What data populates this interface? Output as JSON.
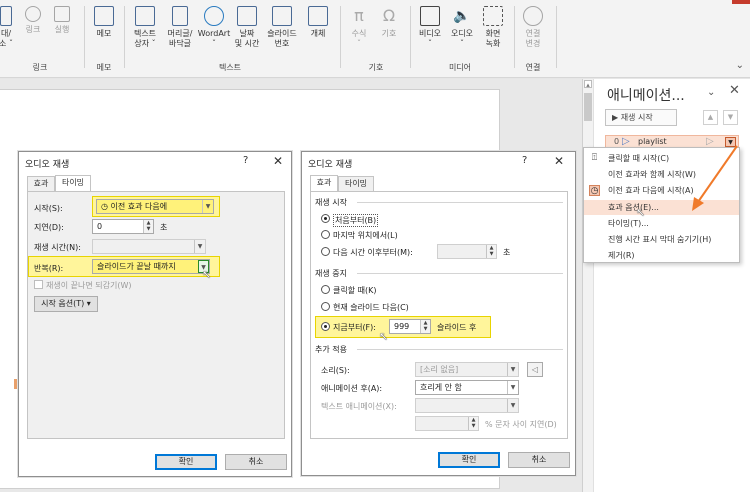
{
  "ribbon": {
    "partial_labels": [
      "대/",
      "소 ˇ",
      "링크",
      "실행",
      "링크"
    ],
    "groups": {
      "memo": "메모",
      "text": "텍스트",
      "symbols": "기호",
      "media": "미디어",
      "connect": "연결"
    },
    "buttons": {
      "memo": "메모",
      "textbox_l1": "텍스트",
      "textbox_l2": "상자 ˇ",
      "header_l1": "머리글/",
      "header_l2": "바닥글",
      "wordart_l1": "WordArt",
      "wordart_l2": "ˇ",
      "datetime_l1": "날짜",
      "datetime_l2": "및 시간",
      "slidenum_l1": "슬라이드",
      "slidenum_l2": "번호",
      "object": "개체",
      "equation_l1": "수식",
      "equation_l2": "ˇ",
      "symbol": "기호",
      "video_l1": "비디오",
      "video_l2": "ˇ",
      "audio_l1": "오디오",
      "audio_l2": "ˇ",
      "screenrec_l1": "화면",
      "screenrec_l2": "녹화",
      "connect_l1": "연결",
      "connect_l2": "변경"
    }
  },
  "anim_pane": {
    "title": "애니메이션...",
    "play_button": "▶  재생 시작",
    "item": {
      "index": "0",
      "name": "playlist"
    }
  },
  "context_menu": {
    "items": [
      "클릭할 때 시작(C)",
      "이전 효과와 함께 시작(W)",
      "이전 효과 다음에 시작(A)",
      "효과 옵션(E)...",
      "타이밍(T)...",
      "진행 시간 표시 막대 숨기기(H)",
      "제거(R)"
    ]
  },
  "dialog_left": {
    "title": "오디오 재생",
    "help": "?",
    "close": "✕",
    "tabs": [
      "효과",
      "타이밍"
    ],
    "start_label": "시작(S):",
    "start_value": "이전 효과 다음에",
    "delay_label": "지연(D):",
    "delay_value": "0",
    "delay_unit": "초",
    "duration_label": "재생 시간(N):",
    "repeat_label": "반복(R):",
    "repeat_value": "슬라이드가 끝날 때까지",
    "rewind_label": "재생이 끝나면 되감기(W)",
    "trigger_button": "시작 옵션(T) ▾",
    "ok": "확인",
    "cancel": "취소"
  },
  "dialog_right": {
    "title": "오디오 재생",
    "help": "?",
    "close": "✕",
    "tabs": [
      "효과",
      "타이밍"
    ],
    "play_start_title": "재생 시작",
    "opt_beginning": "처음부터(B)",
    "opt_last_pos": "마지막 위치에서(L)",
    "opt_from_time": "다음 시간 이후부터(M):",
    "from_time_unit": "초",
    "stop_title": "재생 중지",
    "opt_on_click": "클릭할 때(K)",
    "opt_after_current": "현재 슬라이드 다음(C)",
    "opt_after_label": "지금부터(F):",
    "opt_after_value": "999",
    "opt_after_unit": "슬라이드 후",
    "enhance_title": "추가 적용",
    "sound_label": "소리(S):",
    "sound_value": "[소리 없음]",
    "after_anim_label": "애니메이션 후(A):",
    "after_anim_value": "흐리게 안 함",
    "animate_text_label": "텍스트 애니메이션(X):",
    "delay_between_label": "% 문자 사이 지연(D)",
    "ok": "확인",
    "cancel": "취소"
  },
  "colors": {
    "highlight_yellow": "#fff59b",
    "arrow_orange": "#f07a2a",
    "selection_peach": "#fbe1d4"
  }
}
